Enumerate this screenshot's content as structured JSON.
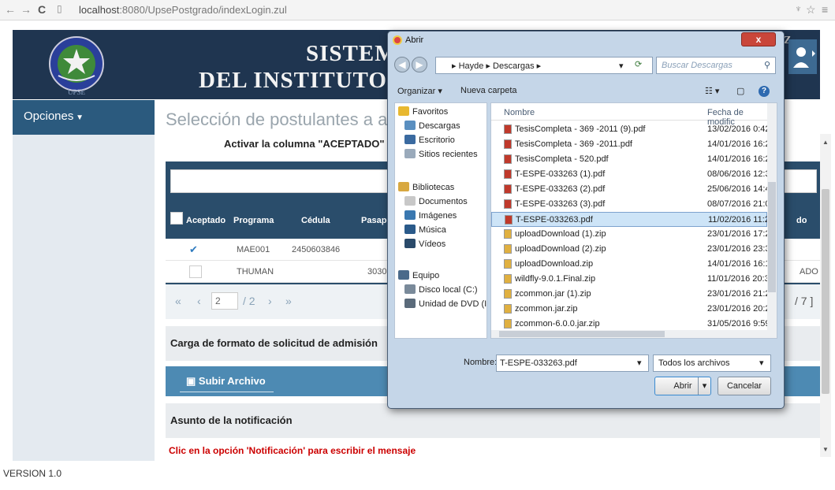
{
  "browser": {
    "url_host": "localhost",
    "url_path": ":8080/UpsePostgrado/indexLogin.zul"
  },
  "header": {
    "title_line1": "SISTEM",
    "title_line2": "DEL INSTITUTO",
    "title_suffix": "Z",
    "logo_text": "UPSE"
  },
  "sidebar": {
    "options_label": "Opciones"
  },
  "main": {
    "page_title": "Selección de postulantes a acepta",
    "instruction": "Activar la columna \"ACEPTADO\" a aque",
    "table": {
      "columns": [
        "Aceptado",
        "Programa",
        "Cédula",
        "Pasapo"
      ],
      "col_tail": "do",
      "rows": [
        {
          "checked": true,
          "programa": "MAE001",
          "cedula": "2450603846",
          "pasaporte": "",
          "tail": ""
        },
        {
          "checked": false,
          "programa": "THUMAN",
          "cedula": "",
          "pasaporte": "30302",
          "tail": "ADO"
        }
      ],
      "pager": {
        "current": "2",
        "total": "/ 2",
        "tail": "/ 7 ]"
      }
    },
    "upload_section": "Carga de formato de solicitud de admisión",
    "upload_button": "Subir Archivo",
    "notification_section": "Asunto de la notificación",
    "notification_hint": "Clic en la opción 'Notificación' para escribir el mensaje"
  },
  "footer": {
    "version": "VERSION 1.0"
  },
  "dialog": {
    "title": "Abrir",
    "path": [
      "Hayde",
      "Descargas"
    ],
    "search_placeholder": "Buscar Descargas",
    "organize": "Organizar ▾",
    "new_folder": "Nueva carpeta",
    "tree": [
      {
        "label": "Favoritos",
        "icon": "star-icon",
        "color": "#e8b830"
      },
      {
        "label": "Descargas",
        "icon": "folder-icon",
        "color": "#5a8fc0"
      },
      {
        "label": "Escritorio",
        "icon": "desktop-icon",
        "color": "#3a6aa0"
      },
      {
        "label": "Sitios recientes",
        "icon": "recent-icon",
        "color": "#9aaabb"
      },
      {
        "label": "Bibliotecas",
        "icon": "library-icon",
        "color": "#d8a840"
      },
      {
        "label": "Documentos",
        "icon": "documents-icon",
        "color": "#c8c8c8"
      },
      {
        "label": "Imágenes",
        "icon": "images-icon",
        "color": "#3a78b0"
      },
      {
        "label": "Música",
        "icon": "music-icon",
        "color": "#2a5a8a"
      },
      {
        "label": "Vídeos",
        "icon": "video-icon",
        "color": "#2a4a6a"
      },
      {
        "label": "Equipo",
        "icon": "computer-icon",
        "color": "#4a6a8a"
      },
      {
        "label": "Disco local (C:)",
        "icon": "drive-icon",
        "color": "#7a8a9a"
      },
      {
        "label": "Unidad de DVD (I",
        "icon": "dvd-icon",
        "color": "#5a6a7a"
      }
    ],
    "columns": {
      "name": "Nombre",
      "date": "Fecha de modific"
    },
    "files": [
      {
        "name": "TesisCompleta - 369 -2011 (9).pdf",
        "date": "13/02/2016 0:42",
        "type": "pdf"
      },
      {
        "name": "TesisCompleta - 369 -2011.pdf",
        "date": "14/01/2016 16:26",
        "type": "pdf"
      },
      {
        "name": "TesisCompleta - 520.pdf",
        "date": "14/01/2016 16:28",
        "type": "pdf"
      },
      {
        "name": "T-ESPE-033263 (1).pdf",
        "date": "08/06/2016 12:35",
        "type": "pdf"
      },
      {
        "name": "T-ESPE-033263 (2).pdf",
        "date": "25/06/2016 14:45",
        "type": "pdf"
      },
      {
        "name": "T-ESPE-033263 (3).pdf",
        "date": "08/07/2016 21:01",
        "type": "pdf"
      },
      {
        "name": "T-ESPE-033263.pdf",
        "date": "11/02/2016 11:24",
        "type": "pdf",
        "selected": true
      },
      {
        "name": "uploadDownload (1).zip",
        "date": "23/01/2016 17:24",
        "type": "zip"
      },
      {
        "name": "uploadDownload (2).zip",
        "date": "23/01/2016 23:38",
        "type": "zip"
      },
      {
        "name": "uploadDownload.zip",
        "date": "14/01/2016 16:17",
        "type": "zip"
      },
      {
        "name": "wildfly-9.0.1.Final.zip",
        "date": "11/01/2016 20:37",
        "type": "zip"
      },
      {
        "name": "zcommon.jar (1).zip",
        "date": "23/01/2016 21:28",
        "type": "zip"
      },
      {
        "name": "zcommon.jar.zip",
        "date": "23/01/2016 20:24",
        "type": "zip"
      },
      {
        "name": "zcommon-6.0.0.jar.zip",
        "date": "31/05/2016 9:59",
        "type": "zip"
      }
    ],
    "name_label": "Nombre:",
    "name_value": "T-ESPE-033263.pdf",
    "file_type": "Todos los archivos",
    "open_button": "Abrir",
    "cancel_button": "Cancelar"
  },
  "colors": {
    "header_bg": "#1f3550",
    "sidebar_active": "#2b5a7e",
    "upload_bar": "#4d8ab3",
    "hint_red": "#cc0000",
    "pdf_icon": "#c0392b",
    "zip_icon": "#e0b040"
  }
}
